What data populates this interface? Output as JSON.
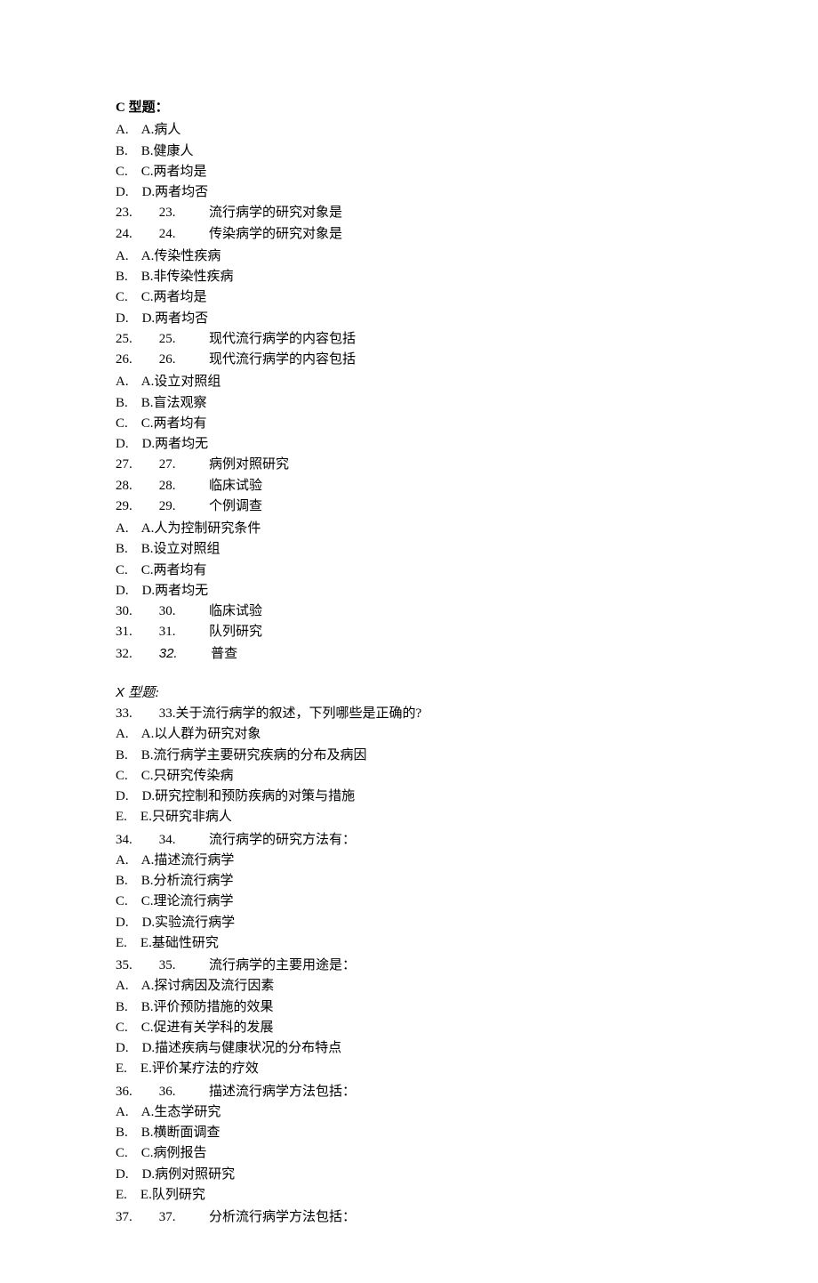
{
  "sectionC": {
    "header": "C 型题：",
    "group1": {
      "options": [
        "A.    A.病人",
        "B.    B.健康人",
        "C.    C.两者均是",
        "D.    D.两者均否"
      ],
      "questions": [
        "23.        23.          流行病学的研究对象是",
        "24.        24.          传染病学的研究对象是"
      ]
    },
    "group2": {
      "options": [
        "A.    A.传染性疾病",
        "B.    B.非传染性疾病",
        "C.    C.两者均是",
        "D.    D.两者均否"
      ],
      "questions": [
        "25.        25.          现代流行病学的内容包括",
        "26.        26.          现代流行病学的内容包括"
      ]
    },
    "group3": {
      "options": [
        "A.    A.设立对照组",
        "B.    B.盲法观察",
        "C.    C.两者均有",
        "D.    D.两者均无"
      ],
      "questions": [
        "27.        27.          病例对照研究",
        "28.        28.          临床试验",
        "29.        29.          个例调查"
      ]
    },
    "group4": {
      "options": [
        "A.    A.人为控制研究条件",
        "B.    B.设立对照组",
        "C.    C.两者均有",
        "D.    D.两者均无"
      ],
      "questions": [
        "30.        30.          临床试验",
        "31.        31.          队列研究"
      ],
      "q32_prefix": "32.        ",
      "q32_num": "32.",
      "q32_text": "          普查"
    }
  },
  "sectionX": {
    "header_prefix": "X ",
    "header_text": "型题:",
    "q33": {
      "stem": "33.        33.关于流行病学的叙述，下列哪些是正确的?",
      "options": [
        "A.    A.以人群为研究对象",
        "B.    B.流行病学主要研究疾病的分布及病因",
        "C.    C.只研究传染病",
        "D.    D.研究控制和预防疾病的对策与措施",
        "E.    E.只研究非病人"
      ]
    },
    "q34": {
      "stem": "34.        34.          流行病学的研究方法有：",
      "options": [
        "A.    A.描述流行病学",
        "B.    B.分析流行病学",
        "C.    C.理论流行病学",
        "D.    D.实验流行病学",
        "E.    E.基础性研究"
      ]
    },
    "q35": {
      "stem": "35.        35.          流行病学的主要用途是：",
      "options": [
        "A.    A.探讨病因及流行因素",
        "B.    B.评价预防措施的效果",
        "C.    C.促进有关学科的发展",
        "D.    D.描述疾病与健康状况的分布特点",
        "E.    E.评价某疗法的疗效"
      ]
    },
    "q36": {
      "stem": "36.        36.          描述流行病学方法包括：",
      "options": [
        "A.    A.生态学研究",
        "B.    B.横断面调查",
        "C.    C.病例报告",
        "D.    D.病例对照研究",
        "E.    E.队列研究"
      ]
    },
    "q37": {
      "stem": "37.        37.          分析流行病学方法包括："
    }
  }
}
